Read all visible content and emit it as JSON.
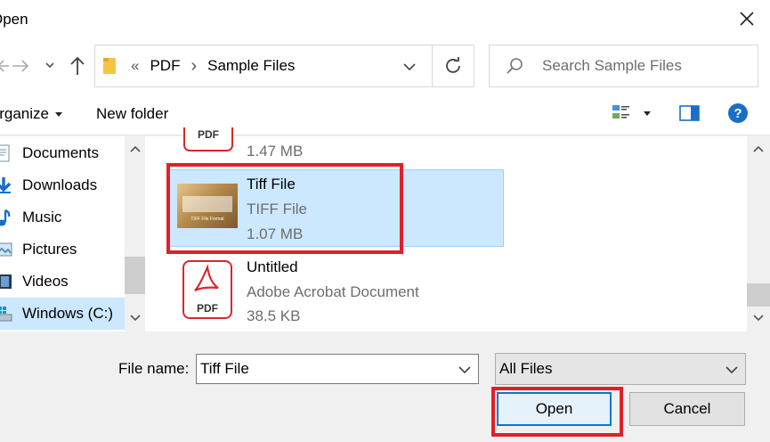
{
  "window": {
    "title": "Open"
  },
  "address": {
    "overflow": "«",
    "crumb1": "PDF",
    "sep": "›",
    "crumb2": "Sample Files"
  },
  "search": {
    "placeholder": "Search Sample Files"
  },
  "toolbar": {
    "organize": "Organize",
    "new_folder": "New folder",
    "help": "?"
  },
  "sidebar": {
    "items": [
      {
        "label": "Documents",
        "icon": "documents-icon"
      },
      {
        "label": "Downloads",
        "icon": "downloads-icon"
      },
      {
        "label": "Music",
        "icon": "music-icon"
      },
      {
        "label": "Pictures",
        "icon": "pictures-icon"
      },
      {
        "label": "Videos",
        "icon": "videos-icon"
      },
      {
        "label": "Windows (C:)",
        "icon": "drive-icon"
      }
    ]
  },
  "files": [
    {
      "name": "",
      "type": "",
      "size": "1.47 MB",
      "badge": "PDF"
    },
    {
      "name": "Tiff File",
      "type": "TIFF File",
      "size": "1.07 MB",
      "thumb_caption": "TIFF File Format"
    },
    {
      "name": "Untitled",
      "type": "Adobe Acrobat Document",
      "size": "38.5 KB",
      "badge": "PDF"
    }
  ],
  "footer": {
    "filename_label": "File name:",
    "filename_value": "Tiff File",
    "filetype_value": "All Files",
    "open": "Open",
    "cancel": "Cancel"
  },
  "colors": {
    "selection": "#cce8ff",
    "highlight_border": "#e0202a",
    "accent": "#0078d7",
    "pdf_red": "#d9272e"
  }
}
